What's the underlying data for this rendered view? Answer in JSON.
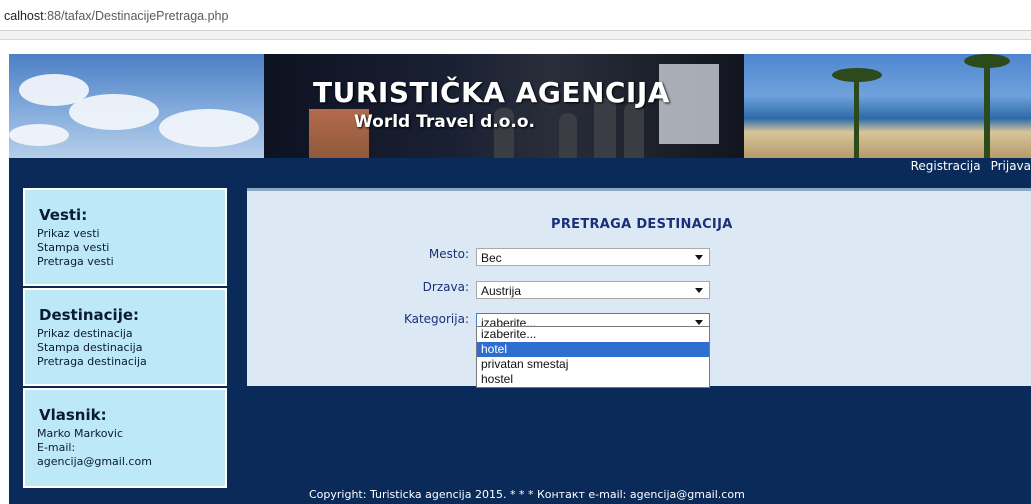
{
  "browser": {
    "url_prefix": "calhost",
    "url_rest": ":88/tafax/DestinacijePretraga.php"
  },
  "banner": {
    "title": "TURISTIČKA AGENCIJA",
    "subtitle": "World Travel d.o.o."
  },
  "topnav": {
    "registracija": "Registracija",
    "prijava": "Prijava"
  },
  "sidebar": {
    "vesti": {
      "heading": "Vesti:",
      "links": [
        "Prikaz vesti",
        "Stampa vesti",
        "Pretraga vesti"
      ]
    },
    "destinacije": {
      "heading": "Destinacije:",
      "links": [
        "Prikaz destinacija",
        "Stampa destinacija",
        "Pretraga destinacija"
      ]
    },
    "vlasnik": {
      "heading": "Vlasnik:",
      "name": "Marko Markovic",
      "email_label": "E-mail:",
      "email": "agencija@gmail.com"
    }
  },
  "form": {
    "title": "PRETRAGA DESTINACIJA",
    "mesto_label": "Mesto:",
    "mesto_value": "Bec",
    "drzava_label": "Drzava:",
    "drzava_value": "Austrija",
    "kategorija_label": "Kategorija:",
    "kategorija_value": "izaberite...",
    "kategorija_options": [
      "izaberite...",
      "hotel",
      "privatan smestaj",
      "hostel"
    ],
    "highlighted_option": "hotel"
  },
  "footer": {
    "text": "Copyright: Turisticka agencija 2015. * * * Контакт e-mail: agencija@gmail.com"
  },
  "colors": {
    "page_background": "#0a2a5a",
    "sidebar_box": "#bde9f7",
    "content_panel": "#dce9f5",
    "label_text": "#1a2f7a",
    "option_highlight": "#2d6ecf"
  }
}
